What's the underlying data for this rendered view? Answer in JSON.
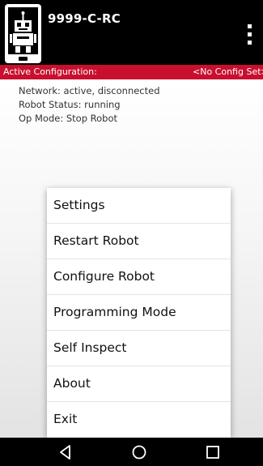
{
  "app_bar": {
    "title": "9999-C-RC",
    "logo_icon": "robot-icon",
    "overflow_icon": "more-vert-icon"
  },
  "config_bar": {
    "label": "Active Configuration:",
    "value": "<No Config Set>",
    "color": "#c8102e"
  },
  "status": {
    "network": "Network: active, disconnected",
    "robot_status": "Robot Status: running",
    "op_mode": "Op Mode: Stop Robot"
  },
  "menu": {
    "items": [
      {
        "label": "Settings"
      },
      {
        "label": "Restart Robot"
      },
      {
        "label": "Configure Robot"
      },
      {
        "label": "Programming Mode"
      },
      {
        "label": "Self Inspect"
      },
      {
        "label": "About"
      },
      {
        "label": "Exit"
      }
    ]
  },
  "nav_bar": {
    "back_icon": "back-triangle-icon",
    "home_icon": "home-circle-icon",
    "recents_icon": "recents-square-icon"
  }
}
